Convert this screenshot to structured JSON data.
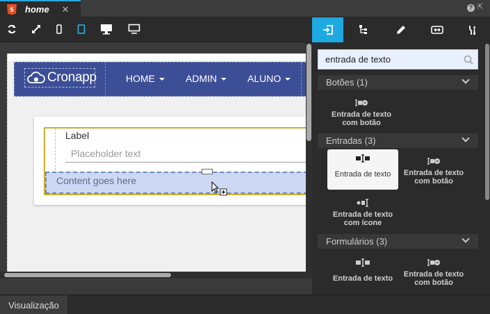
{
  "tab": {
    "title": "home",
    "close": "✕",
    "file_badge": "5"
  },
  "window": {
    "help": "?",
    "restore": "⇱"
  },
  "toolbar": {
    "icons": [
      "refresh-icon",
      "expand-icon",
      "mobile-icon",
      "tablet-icon",
      "desktop-icon",
      "monitor-icon"
    ],
    "active_color": "#2aa7e0"
  },
  "preview": {
    "logo": "Cronapp",
    "nav": [
      {
        "label": "HOME"
      },
      {
        "label": "ADMIN"
      },
      {
        "label": "ALUNO"
      }
    ],
    "field_label": "Label",
    "placeholder": "Placeholder text",
    "dropzone_text": "Content goes here",
    "navbar_color": "#3c4e96",
    "selection_color": "#c8ae2e"
  },
  "panel": {
    "tabs": [
      "insert-component-icon",
      "tree-icon",
      "pencil-icon",
      "resize-icon",
      "tools-icon"
    ],
    "active_color": "#1ea9e1",
    "search_value": "entrada de texto",
    "sections": [
      {
        "title": "Botões (1)",
        "items": [
          "Entrada de texto com botão"
        ]
      },
      {
        "title": "Entradas (3)",
        "items": [
          "Entrada de texto",
          "Entrada de texto com botão",
          "Entrada de texto com ícone"
        ]
      },
      {
        "title": "Formulários (3)",
        "items": [
          "Entrada de texto",
          "Entrada de texto com botão"
        ]
      }
    ]
  },
  "bottom": {
    "view_tab": "Visualização"
  }
}
